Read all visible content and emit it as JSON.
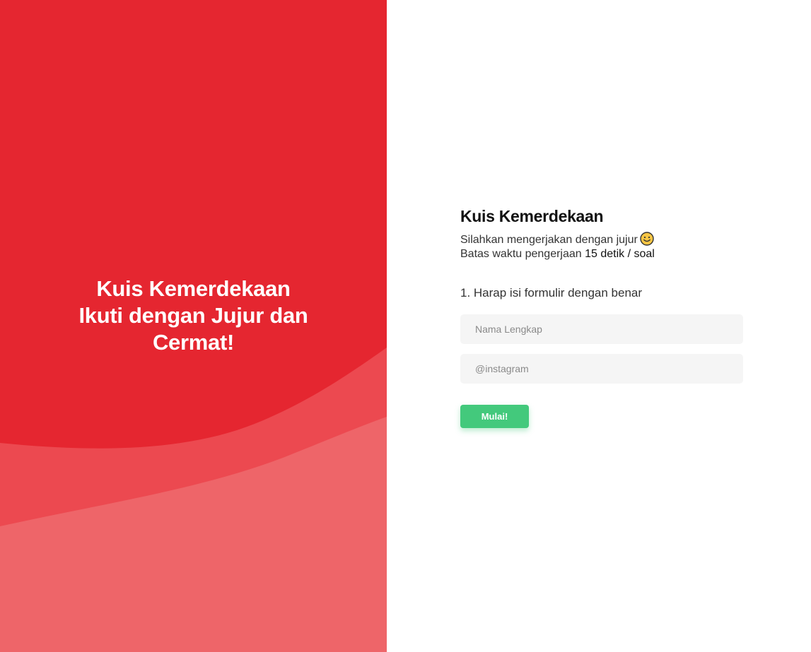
{
  "left": {
    "hero_line1": "Kuis Kemerdekaan",
    "hero_line2": "Ikuti dengan Jujur dan",
    "hero_line3": "Cermat!",
    "colors": {
      "base": "#e52630",
      "wave_mid": "#ec4950",
      "wave_light": "#ee6569"
    }
  },
  "form": {
    "title": "Kuis Kemerdekaan",
    "subtitle_line1": "Silahkan mengerjakan dengan jujur",
    "subtitle_icon": "smile-emoji-icon",
    "subtitle_line2_prefix": "Batas waktu pengerjaan",
    "subtitle_line2_highlight": "15 detik / soal",
    "question": "1. Harap isi formulir dengan benar",
    "name_placeholder": "Nama Lengkap",
    "instagram_placeholder": "@instagram",
    "submit_label": "Mulai!",
    "accent_color": "#43c97c"
  }
}
